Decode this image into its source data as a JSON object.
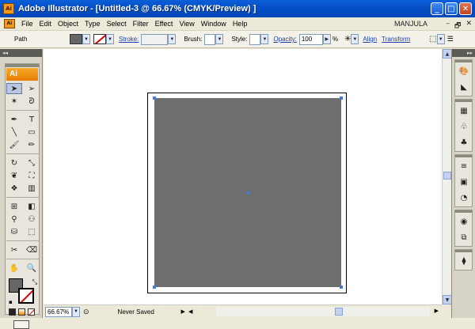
{
  "window": {
    "title": "Adobe Illustrator - [Untitled-3 @ 66.67% (CMYK/Preview) ]",
    "app_icon_text": "Ai",
    "buttons": {
      "minimize": "_",
      "maximize": "□",
      "close": "✕"
    }
  },
  "menubar": {
    "doc_icon_text": "Ai",
    "items": [
      "File",
      "Edit",
      "Object",
      "Type",
      "Select",
      "Filter",
      "Effect",
      "View",
      "Window",
      "Help"
    ],
    "user": "MANJULA",
    "doc_controls": [
      "–",
      "🗗",
      "✕"
    ]
  },
  "controlbar": {
    "selection_label": "Path",
    "fill_color": "#666666",
    "stroke_label": "Stroke:",
    "brush_label": "Brush:",
    "style_label": "Style:",
    "opacity_label": "Opacity:",
    "opacity_value": "100",
    "percent": "%",
    "align_link": "Align",
    "transform_link": "Transform"
  },
  "toolbox": {
    "logo": "Ai",
    "tools": [
      {
        "name": "selection-tool",
        "icon": "➤",
        "active": true
      },
      {
        "name": "direct-selection-tool",
        "icon": "➢"
      },
      {
        "name": "magic-wand-tool",
        "icon": "✶"
      },
      {
        "name": "lasso-tool",
        "icon": "ᘐ"
      },
      {
        "name": "pen-tool",
        "icon": "✒"
      },
      {
        "name": "type-tool",
        "icon": "T"
      },
      {
        "name": "line-segment-tool",
        "icon": "╲"
      },
      {
        "name": "rectangle-tool",
        "icon": "▭"
      },
      {
        "name": "paintbrush-tool",
        "icon": "🖌"
      },
      {
        "name": "pencil-tool",
        "icon": "✏"
      },
      {
        "name": "rotate-tool",
        "icon": "↻"
      },
      {
        "name": "scale-tool",
        "icon": "⤡"
      },
      {
        "name": "warp-tool",
        "icon": "❦"
      },
      {
        "name": "free-transform-tool",
        "icon": "⛶"
      },
      {
        "name": "symbol-sprayer-tool",
        "icon": "❖"
      },
      {
        "name": "column-graph-tool",
        "icon": "▥"
      },
      {
        "name": "mesh-tool",
        "icon": "⊞"
      },
      {
        "name": "gradient-tool",
        "icon": "◧"
      },
      {
        "name": "eyedropper-tool",
        "icon": "⚲"
      },
      {
        "name": "blend-tool",
        "icon": "⚇"
      },
      {
        "name": "live-paint-bucket-tool",
        "icon": "⛁"
      },
      {
        "name": "live-paint-selection-tool",
        "icon": "⬚"
      },
      {
        "name": "slice-tool",
        "icon": "✂"
      },
      {
        "name": "eraser-tool",
        "icon": "⌫"
      },
      {
        "name": "hand-tool",
        "icon": "✋"
      },
      {
        "name": "zoom-tool",
        "icon": "🔍"
      }
    ],
    "fill_color": "#666666",
    "swap_icon": "⤡",
    "default_icon": "▪"
  },
  "canvas": {
    "shape_color": "#6d6e70",
    "anchor_color": "#4a78d8"
  },
  "right_panels": [
    [
      "brushes-icon",
      "gradient-icon"
    ],
    [
      "swatches-icon",
      "symbols-icon",
      "clubs-icon"
    ],
    [
      "stroke-icon",
      "transparency-icon",
      "appearance-icon"
    ],
    [
      "graphic-styles-icon",
      "pathfinder-icon"
    ],
    [
      "layers-icon"
    ]
  ],
  "right_panel_glyphs": {
    "brushes-icon": "🎨",
    "gradient-icon": "◣",
    "swatches-icon": "▦",
    "symbols-icon": "♧",
    "clubs-icon": "♣",
    "stroke-icon": "≡",
    "transparency-icon": "▣",
    "appearance-icon": "◔",
    "graphic-styles-icon": "◉",
    "pathfinder-icon": "⧉",
    "layers-icon": "⧫"
  },
  "statusbar": {
    "zoom": "66.67%",
    "status": "Never Saved"
  }
}
